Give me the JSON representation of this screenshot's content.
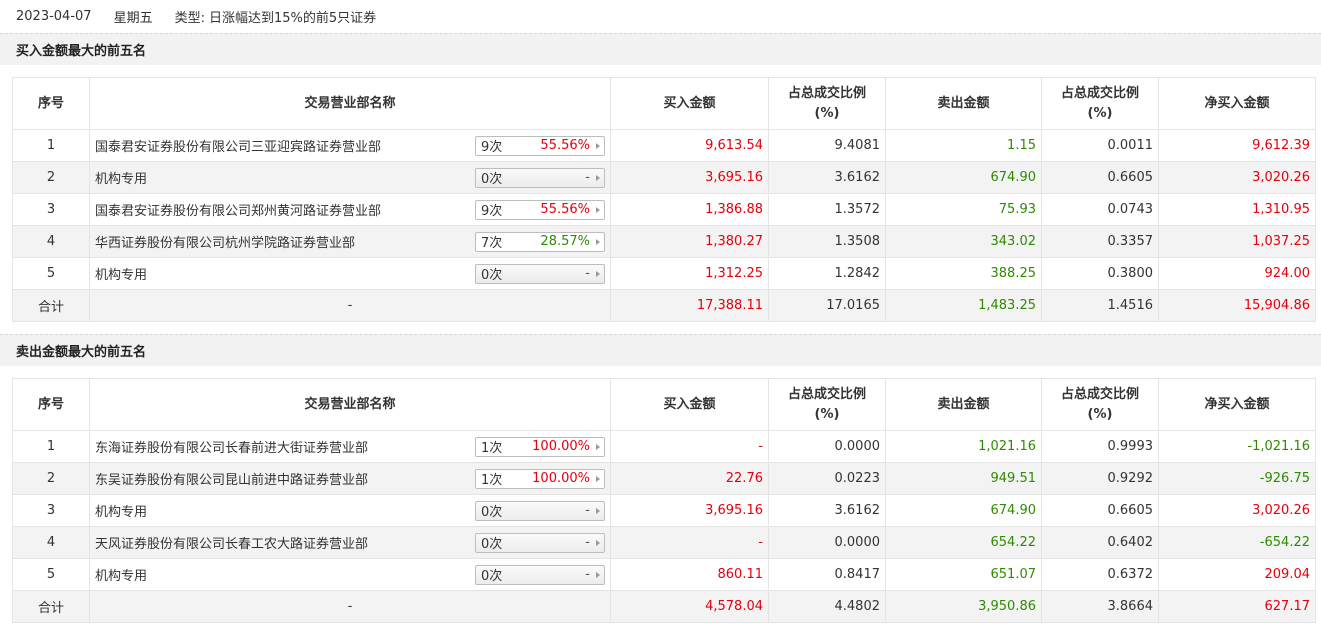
{
  "top": {
    "date": "2023-04-07",
    "weekday": "星期五",
    "type_label": "类型:",
    "type_value": "日涨幅达到15%的前5只证券"
  },
  "colors": {
    "red": "#e4000c",
    "green": "#2e8b00"
  },
  "columns": {
    "idx": "序号",
    "name": "交易营业部名称",
    "buy": "买入金额",
    "buy_pct_l1": "占总成交比例",
    "buy_pct_l2": "(%)",
    "sell": "卖出金额",
    "sell_pct_l1": "占总成交比例",
    "sell_pct_l2": "(%)",
    "net": "净买入金额"
  },
  "buy_section": {
    "title": "买入金额最大的前五名",
    "rows": [
      {
        "idx": "1",
        "name": "国泰君安证券股份有限公司三亚迎宾路证券营业部",
        "count": "9次",
        "rate": "55.56%",
        "buy": "9,613.54",
        "buy_pct": "9.4081",
        "sell": "1.15",
        "sell_pct": "0.0011",
        "net": "9,612.39",
        "net_color": "red"
      },
      {
        "idx": "2",
        "name": "机构专用",
        "count": "0次",
        "rate": "-",
        "buy": "3,695.16",
        "buy_pct": "3.6162",
        "sell": "674.90",
        "sell_pct": "0.6605",
        "net": "3,020.26",
        "net_color": "red"
      },
      {
        "idx": "3",
        "name": "国泰君安证券股份有限公司郑州黄河路证券营业部",
        "count": "9次",
        "rate": "55.56%",
        "buy": "1,386.88",
        "buy_pct": "1.3572",
        "sell": "75.93",
        "sell_pct": "0.0743",
        "net": "1,310.95",
        "net_color": "red"
      },
      {
        "idx": "4",
        "name": "华西证券股份有限公司杭州学院路证券营业部",
        "count": "7次",
        "rate": "28.57%",
        "buy": "1,380.27",
        "buy_pct": "1.3508",
        "sell": "343.02",
        "sell_pct": "0.3357",
        "net": "1,037.25",
        "net_color": "red"
      },
      {
        "idx": "5",
        "name": "机构专用",
        "count": "0次",
        "rate": "-",
        "buy": "1,312.25",
        "buy_pct": "1.2842",
        "sell": "388.25",
        "sell_pct": "0.3800",
        "net": "924.00",
        "net_color": "red"
      }
    ],
    "total": {
      "label": "合计",
      "name": "-",
      "buy": "17,388.11",
      "buy_pct": "17.0165",
      "sell": "1,483.25",
      "sell_pct": "1.4516",
      "net": "15,904.86",
      "net_color": "red"
    }
  },
  "sell_section": {
    "title": "卖出金额最大的前五名",
    "rows": [
      {
        "idx": "1",
        "name": "东海证券股份有限公司长春前进大街证券营业部",
        "count": "1次",
        "rate": "100.00%",
        "buy": "-",
        "buy_pct": "0.0000",
        "sell": "1,021.16",
        "sell_pct": "0.9993",
        "net": "-1,021.16",
        "net_color": "green"
      },
      {
        "idx": "2",
        "name": "东吴证券股份有限公司昆山前进中路证券营业部",
        "count": "1次",
        "rate": "100.00%",
        "buy": "22.76",
        "buy_pct": "0.0223",
        "sell": "949.51",
        "sell_pct": "0.9292",
        "net": "-926.75",
        "net_color": "green"
      },
      {
        "idx": "3",
        "name": "机构专用",
        "count": "0次",
        "rate": "-",
        "buy": "3,695.16",
        "buy_pct": "3.6162",
        "sell": "674.90",
        "sell_pct": "0.6605",
        "net": "3,020.26",
        "net_color": "red"
      },
      {
        "idx": "4",
        "name": "天风证券股份有限公司长春工农大路证券营业部",
        "count": "0次",
        "rate": "-",
        "buy": "-",
        "buy_pct": "0.0000",
        "sell": "654.22",
        "sell_pct": "0.6402",
        "net": "-654.22",
        "net_color": "green"
      },
      {
        "idx": "5",
        "name": "机构专用",
        "count": "0次",
        "rate": "-",
        "buy": "860.11",
        "buy_pct": "0.8417",
        "sell": "651.07",
        "sell_pct": "0.6372",
        "net": "209.04",
        "net_color": "red"
      }
    ],
    "total": {
      "label": "合计",
      "name": "-",
      "buy": "4,578.04",
      "buy_pct": "4.4802",
      "sell": "3,950.86",
      "sell_pct": "3.8664",
      "net": "627.17",
      "net_color": "red"
    }
  }
}
